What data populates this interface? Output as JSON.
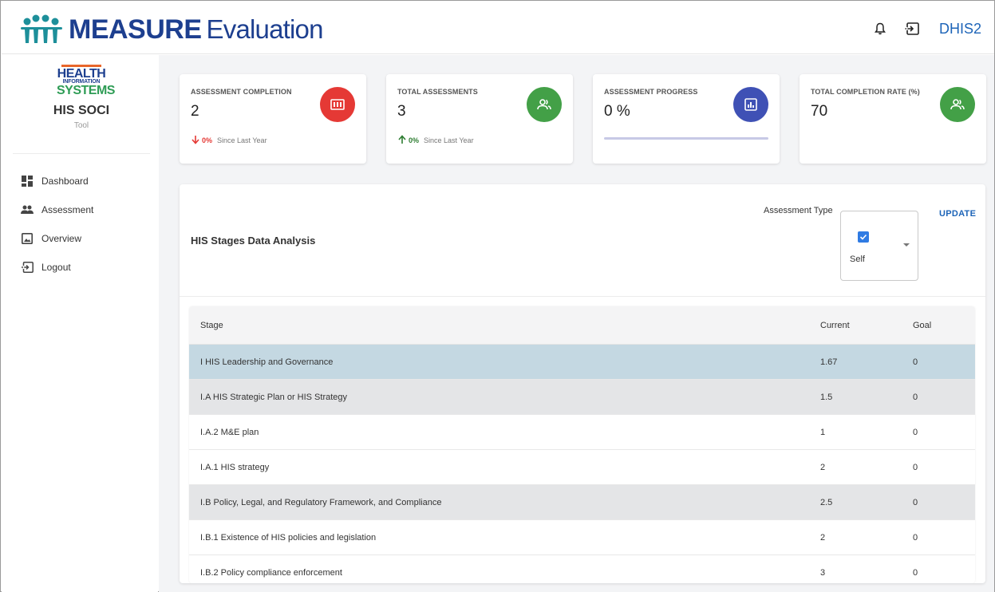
{
  "header": {
    "logo_bold": "MEASURE",
    "logo_light": "Evaluation",
    "dhis2_label": "DHIS2",
    "icons": [
      "bell-icon",
      "logout-icon"
    ]
  },
  "sidebar": {
    "logo": {
      "health": "HEALTH",
      "information": "INFORMATION",
      "systems": "SYSTEMS"
    },
    "title": "HIS SOCI",
    "subtitle": "Tool",
    "items": [
      {
        "label": "Dashboard",
        "icon": "dashboard-icon"
      },
      {
        "label": "Assessment",
        "icon": "people-icon"
      },
      {
        "label": "Overview",
        "icon": "photo-icon"
      },
      {
        "label": "Logout",
        "icon": "logout-icon"
      }
    ]
  },
  "cards": [
    {
      "label": "ASSESSMENT COMPLETION",
      "value": "2",
      "trend_pct": "0%",
      "trend_text": "Since Last Year",
      "trend_dir": "down",
      "color": "#e53935",
      "icon": "counter-icon"
    },
    {
      "label": "TOTAL ASSESSMENTS",
      "value": "3",
      "trend_pct": "0%",
      "trend_text": "Since Last Year",
      "trend_dir": "up",
      "color": "#43a047",
      "icon": "group-icon"
    },
    {
      "label": "ASSESSMENT PROGRESS",
      "value": "0 %",
      "progress": 0,
      "color": "#3f51b5",
      "icon": "bar-chart-icon"
    },
    {
      "label": "TOTAL COMPLETION RATE (%)",
      "value": "70",
      "color": "#43a047",
      "icon": "group-icon"
    }
  ],
  "panel": {
    "title": "HIS Stages Data Analysis",
    "assessment_type_label": "Assessment Type",
    "selected_option": "Self",
    "update_label": "UPDATE"
  },
  "table": {
    "headers": {
      "stage": "Stage",
      "current": "Current",
      "goal": "Goal"
    },
    "rows": [
      {
        "stage": "I HIS Leadership and Governance",
        "current": "1.67",
        "goal": "0",
        "style": "selected"
      },
      {
        "stage": "I.A HIS Strategic Plan or HIS Strategy",
        "current": "1.5",
        "goal": "0",
        "style": "group"
      },
      {
        "stage": "I.A.2 M&E plan",
        "current": "1",
        "goal": "0",
        "style": ""
      },
      {
        "stage": "I.A.1 HIS strategy",
        "current": "2",
        "goal": "0",
        "style": ""
      },
      {
        "stage": "I.B Policy, Legal, and Regulatory Framework, and Compliance",
        "current": "2.5",
        "goal": "0",
        "style": "group"
      },
      {
        "stage": "I.B.1 Existence of HIS policies and legislation",
        "current": "2",
        "goal": "0",
        "style": ""
      },
      {
        "stage": "I.B.2 Policy compliance enforcement",
        "current": "3",
        "goal": "0",
        "style": ""
      }
    ]
  },
  "colors": {
    "brand_blue": "#1d3f8f",
    "link_blue": "#1d64b8",
    "down_red": "#e53935",
    "up_green": "#2e7d32",
    "selected_row": "#c4d8e2",
    "group_row": "#e4e5e7"
  }
}
